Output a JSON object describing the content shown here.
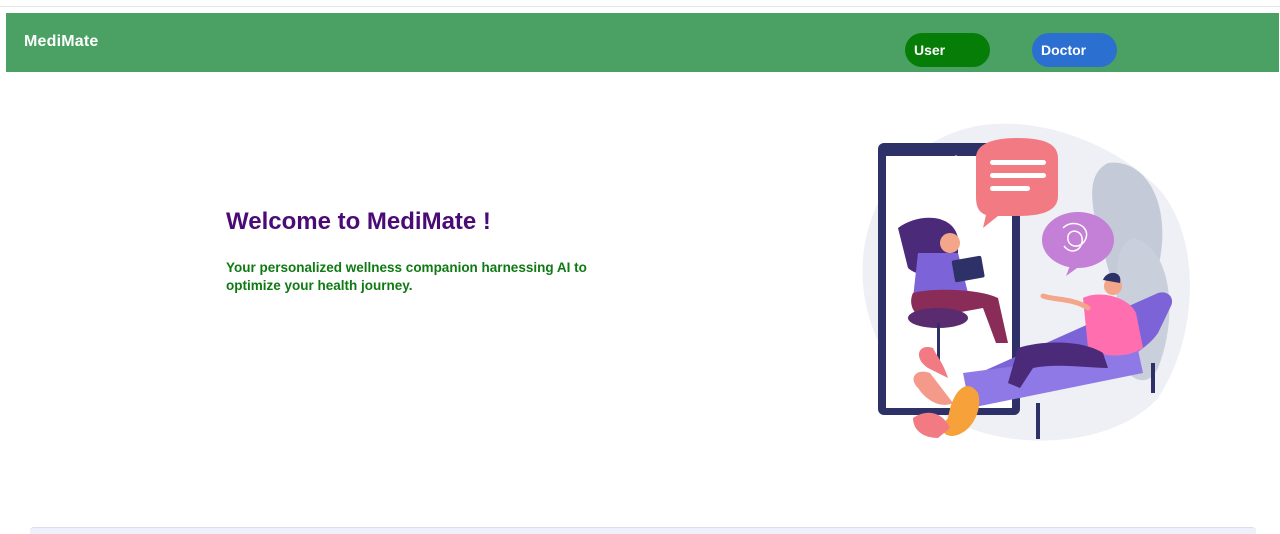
{
  "header": {
    "brand": "MediMate",
    "user_button": "User",
    "doctor_button": "Doctor"
  },
  "hero": {
    "title": "Welcome to MediMate !",
    "subtitle": "Your personalized wellness companion harnessing AI to optimize your health journey."
  },
  "colors": {
    "navbar": "#4aa163",
    "user_button": "#067d06",
    "doctor_button": "#2b6fd0",
    "title": "#4b0b77",
    "subtitle": "#0e7a12"
  },
  "illustration": {
    "icon": "telehealth-consultation-illustration"
  }
}
